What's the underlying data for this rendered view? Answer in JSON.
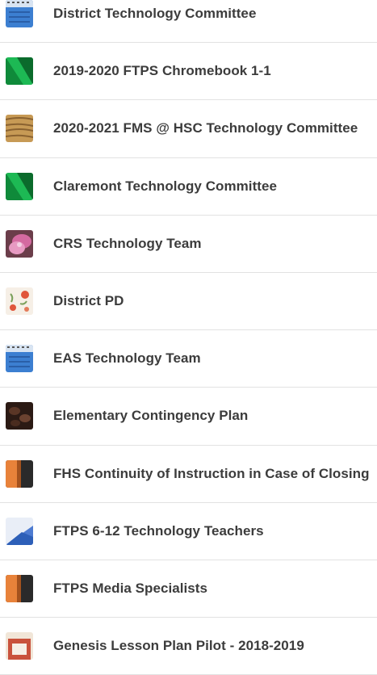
{
  "classes": [
    {
      "name": "District Technology Committee",
      "icon": "notebook-blue-icon"
    },
    {
      "name": "2019-2020 FTPS Chromebook 1-1",
      "icon": "green-triangle-icon"
    },
    {
      "name": "2020-2021 FMS @ HSC Technology Committee",
      "icon": "wood-texture-icon"
    },
    {
      "name": "Claremont Technology Committee",
      "icon": "green-triangle-icon"
    },
    {
      "name": "CRS Technology Team",
      "icon": "pink-flower-icon"
    },
    {
      "name": "District PD",
      "icon": "floral-pattern-icon"
    },
    {
      "name": "EAS Technology Team",
      "icon": "notebook-blue-icon"
    },
    {
      "name": "Elementary Contingency Plan",
      "icon": "coffee-beans-icon"
    },
    {
      "name": "FHS Continuity of Instruction in Case of Closing",
      "icon": "orange-dark-icon"
    },
    {
      "name": "FTPS 6-12 Technology Teachers",
      "icon": "blue-paper-icon"
    },
    {
      "name": "FTPS Media Specialists",
      "icon": "orange-dark-icon"
    },
    {
      "name": "Genesis Lesson Plan Pilot - 2018-2019",
      "icon": "cookbook-icon"
    }
  ]
}
